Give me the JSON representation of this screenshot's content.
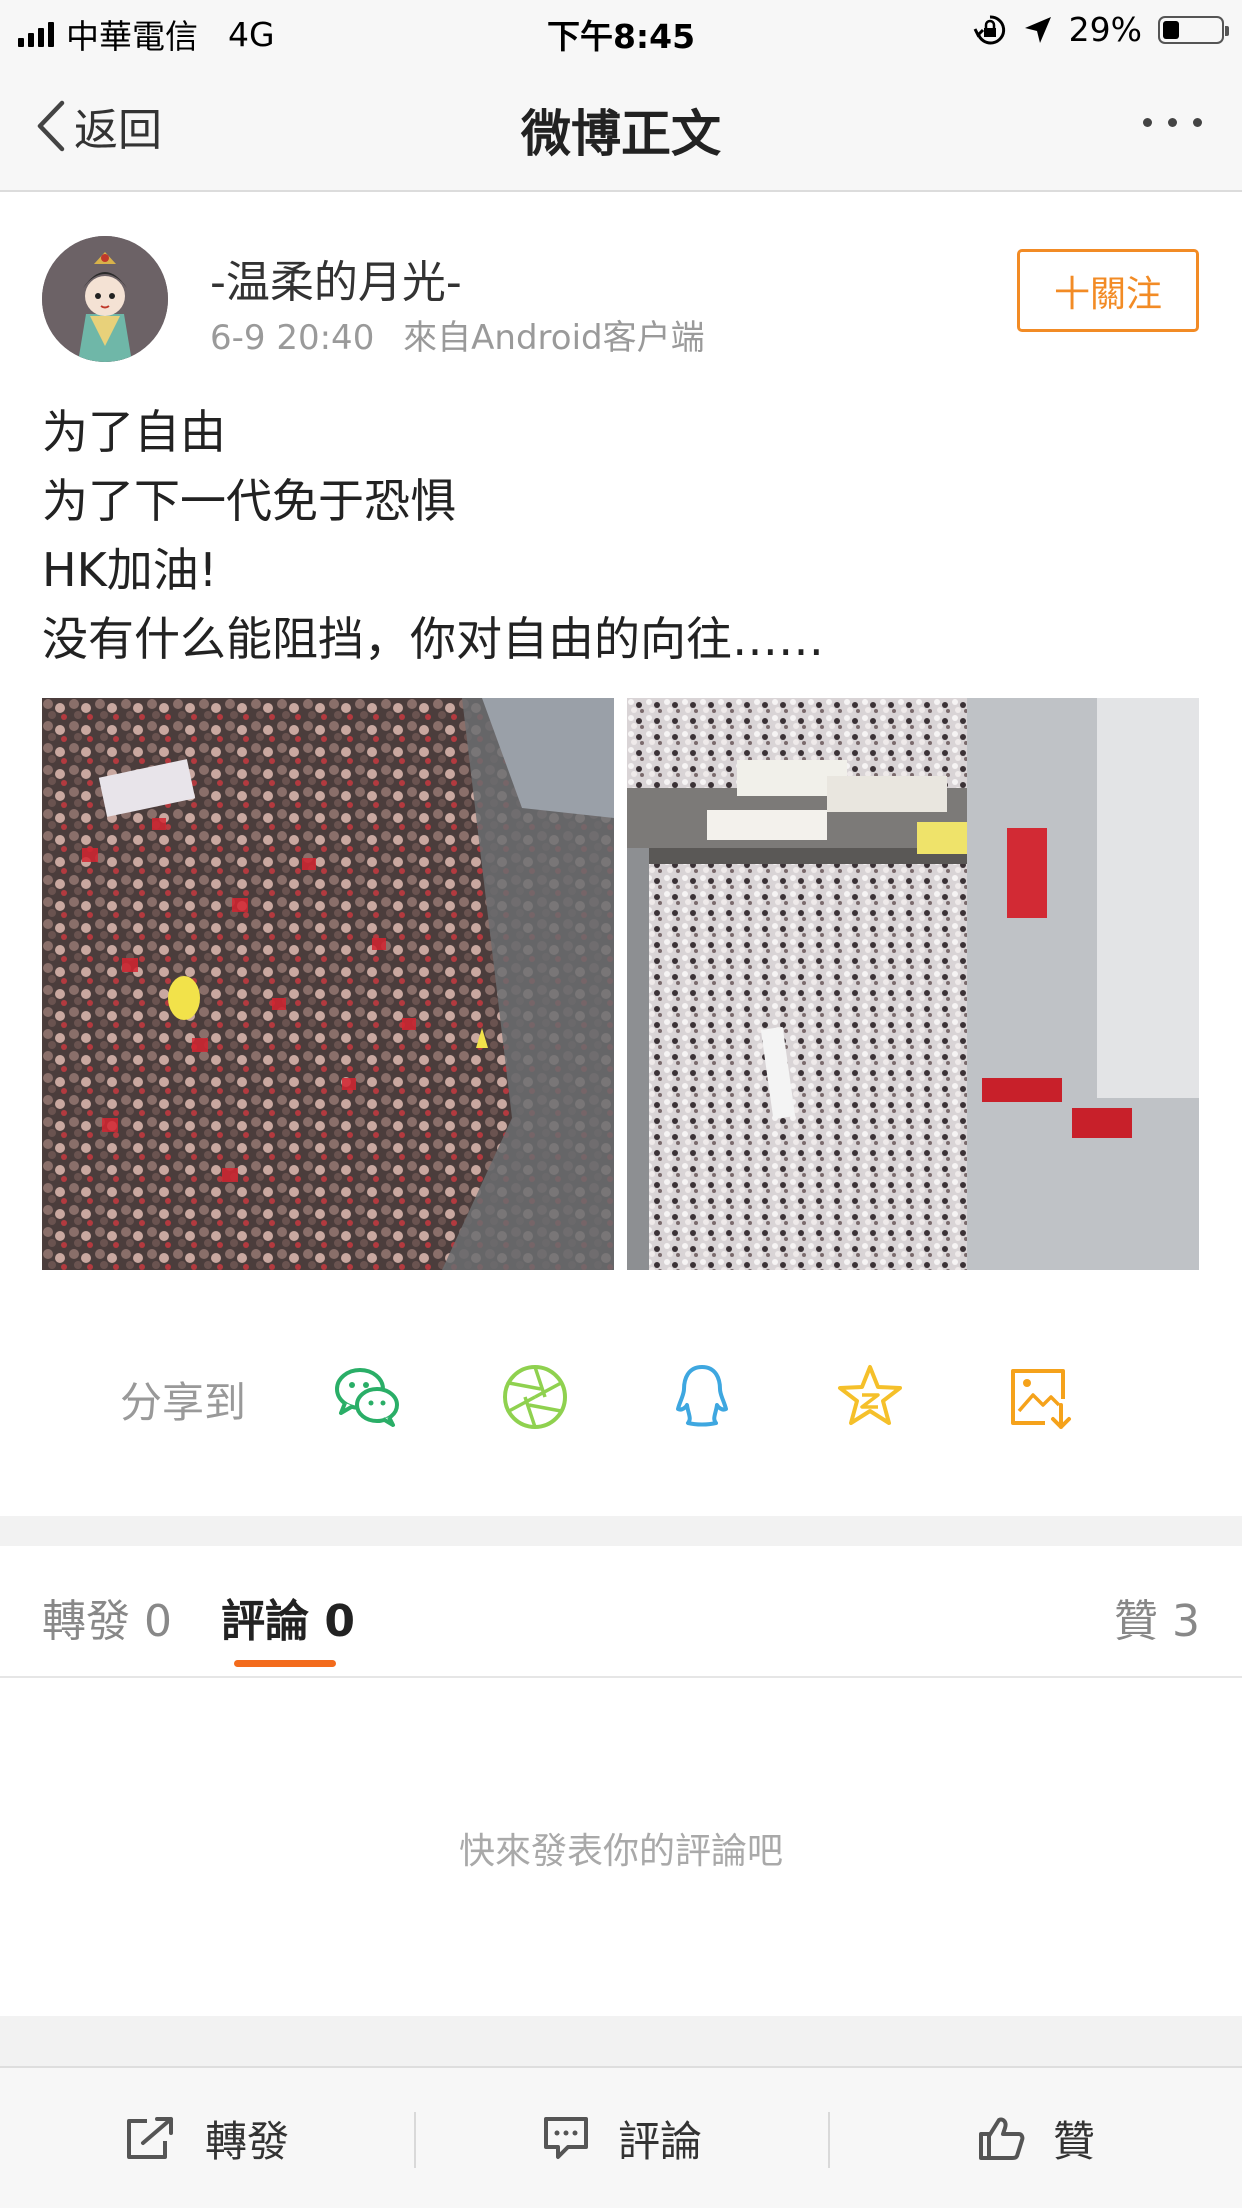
{
  "status_bar": {
    "carrier": "中華電信",
    "network": "4G",
    "time": "下午8:45",
    "battery": "29%",
    "battery_level": 0.29
  },
  "nav": {
    "back_label": "返回",
    "title": "微博正文"
  },
  "post": {
    "username": "-温柔的月光-",
    "time": "6-9 20:40",
    "source": "來自Android客户端",
    "follow_label": "十關注",
    "lines": [
      "为了自由",
      "为了下一代免于恐惧",
      "HK加油!",
      "没有什么能阻挡，你对自由的向往……"
    ]
  },
  "share": {
    "label": "分享到",
    "icons": [
      "wechat-icon",
      "moments-icon",
      "qq-icon",
      "qzone-icon",
      "save-image-icon"
    ],
    "colors": {
      "wechat": "#2aae67",
      "moments": "#8fd14f",
      "qq": "#3ea7e0",
      "qzone": "#f5c02a",
      "save": "#f5a21b"
    }
  },
  "tabs": {
    "repost": "轉發 0",
    "comment_label": "評論",
    "comment_count": "0",
    "like": "贊 3"
  },
  "empty_comments": "快來發表你的評論吧",
  "bottom_bar": {
    "repost": "轉發",
    "comment": "評論",
    "like": "贊"
  },
  "accent_color": "#f28b25"
}
